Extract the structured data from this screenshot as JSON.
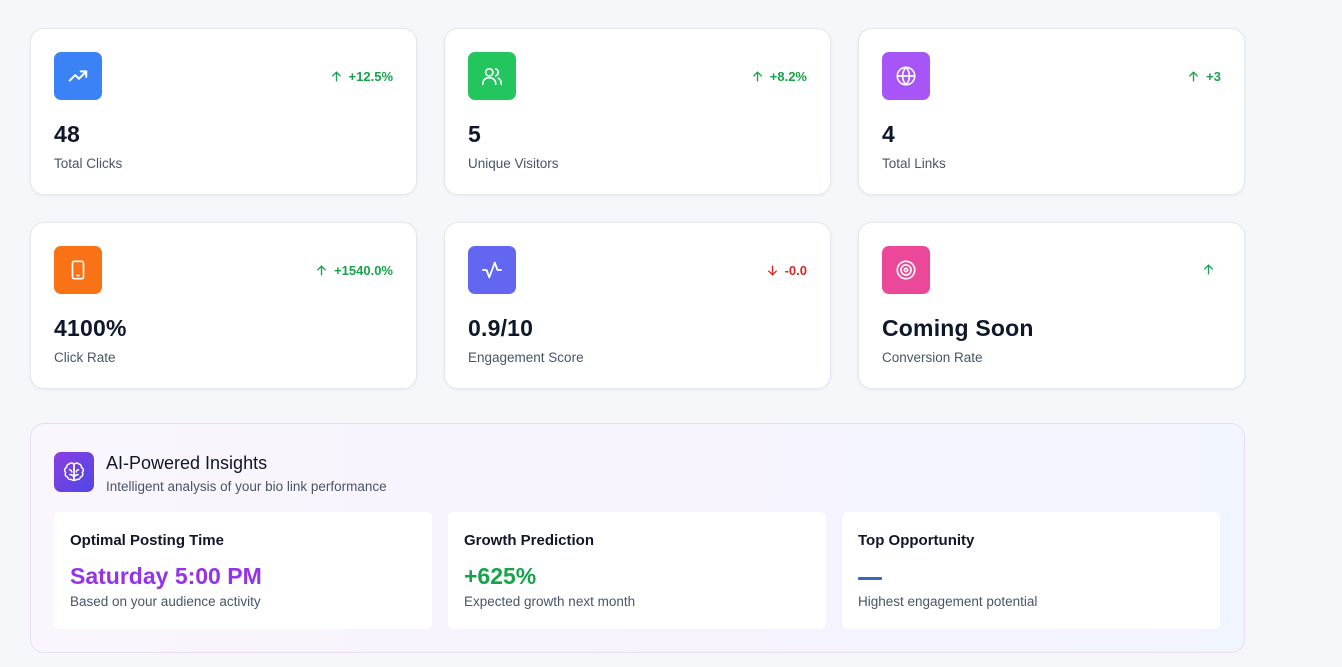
{
  "metrics": [
    {
      "value": "48",
      "label": "Total Clicks",
      "trend": "+12.5%",
      "direction": "up",
      "icon": "trending-up-icon",
      "color": "#3b82f6"
    },
    {
      "value": "5",
      "label": "Unique Visitors",
      "trend": "+8.2%",
      "direction": "up",
      "icon": "users-icon",
      "color": "#22c55e"
    },
    {
      "value": "4",
      "label": "Total Links",
      "trend": "+3",
      "direction": "up",
      "icon": "globe-icon",
      "color": "#a855f7"
    },
    {
      "value": "4100%",
      "label": "Click Rate",
      "trend": "+1540.0%",
      "direction": "up",
      "icon": "smartphone-icon",
      "color": "#f97316"
    },
    {
      "value": "0.9/10",
      "label": "Engagement Score",
      "trend": "-0.0",
      "direction": "down",
      "icon": "activity-icon",
      "color": "#6366f1"
    },
    {
      "value": "Coming Soon",
      "label": "Conversion Rate",
      "trend": "",
      "direction": "up",
      "icon": "target-icon",
      "color": "#ec4899"
    }
  ],
  "ai_insights": {
    "title": "AI-Powered Insights",
    "subtitle": "Intelligent analysis of your bio link performance",
    "icon": "brain-icon",
    "cards": [
      {
        "title": "Optimal Posting Time",
        "value": "Saturday 5:00 PM",
        "caption": "Based on your audience activity",
        "value_color": "#9333ea"
      },
      {
        "title": "Growth Prediction",
        "value": "+625%",
        "caption": "Expected growth next month",
        "value_color": "#16a34a"
      },
      {
        "title": "Top Opportunity",
        "value": "",
        "caption": "Highest engagement potential",
        "value_color": "#3b63c4"
      }
    ]
  },
  "colors": {
    "trend_up": "#16a34a",
    "trend_down": "#dc2626",
    "page_background": "#f5f7fb"
  }
}
